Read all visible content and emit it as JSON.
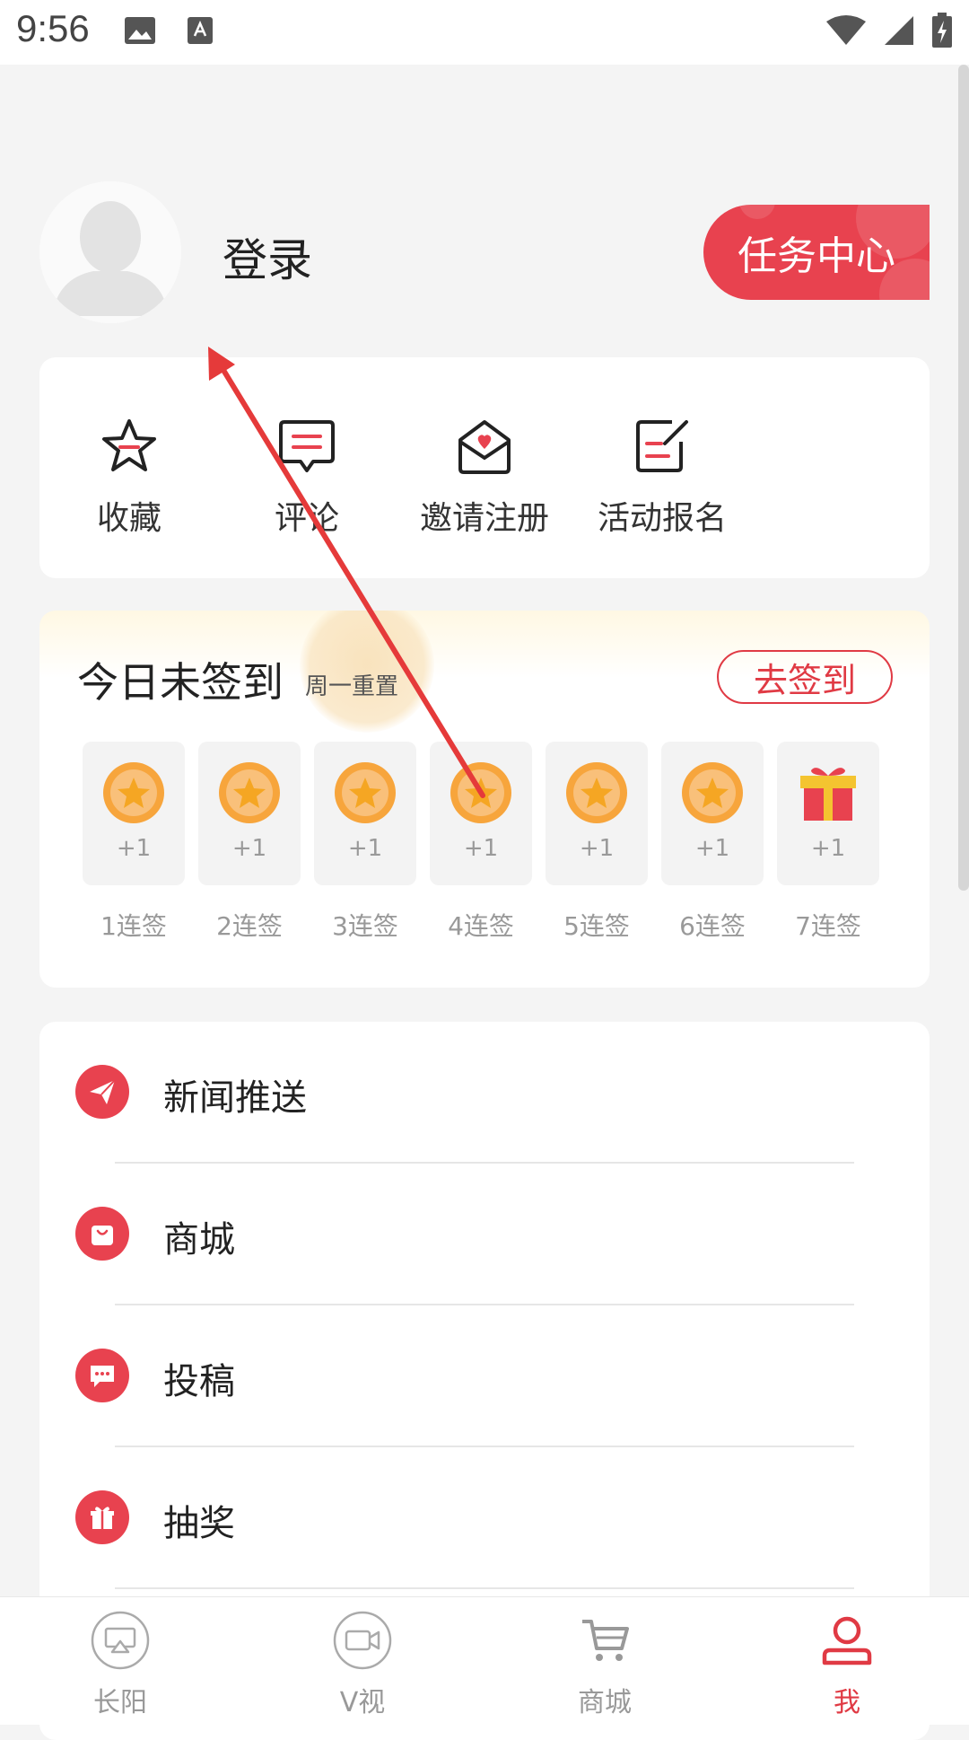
{
  "status_bar": {
    "time": "9:56"
  },
  "header": {
    "login_label": "登录",
    "task_center_label": "任务中心"
  },
  "quick_actions": [
    {
      "label": "收藏",
      "icon": "star-icon"
    },
    {
      "label": "评论",
      "icon": "comment-icon"
    },
    {
      "label": "邀请注册",
      "icon": "invite-icon"
    },
    {
      "label": "活动报名",
      "icon": "signup-icon"
    }
  ],
  "sign_in": {
    "title": "今日未签到",
    "subtitle": "周一重置",
    "button_label": "去签到",
    "days": [
      {
        "reward": "+1",
        "label": "1连签",
        "icon": "coin-icon"
      },
      {
        "reward": "+1",
        "label": "2连签",
        "icon": "coin-icon"
      },
      {
        "reward": "+1",
        "label": "3连签",
        "icon": "coin-icon"
      },
      {
        "reward": "+1",
        "label": "4连签",
        "icon": "coin-icon"
      },
      {
        "reward": "+1",
        "label": "5连签",
        "icon": "coin-icon"
      },
      {
        "reward": "+1",
        "label": "6连签",
        "icon": "coin-icon"
      },
      {
        "reward": "+1",
        "label": "7连签",
        "icon": "gift-icon"
      }
    ]
  },
  "menu": [
    {
      "label": "新闻推送",
      "icon": "paper-plane-icon"
    },
    {
      "label": "商城",
      "icon": "shopping-bag-icon"
    },
    {
      "label": "投稿",
      "icon": "message-icon"
    },
    {
      "label": "抽奖",
      "icon": "gift-icon"
    }
  ],
  "bottom_nav": [
    {
      "label": "长阳",
      "icon": "airplay-icon",
      "active": false
    },
    {
      "label": "V视",
      "icon": "video-icon",
      "active": false
    },
    {
      "label": "商城",
      "icon": "cart-icon",
      "active": false
    },
    {
      "label": "我",
      "icon": "user-icon",
      "active": true
    }
  ],
  "colors": {
    "accent": "#e8424f",
    "coin": "#f5a623",
    "inactive": "#999999"
  }
}
